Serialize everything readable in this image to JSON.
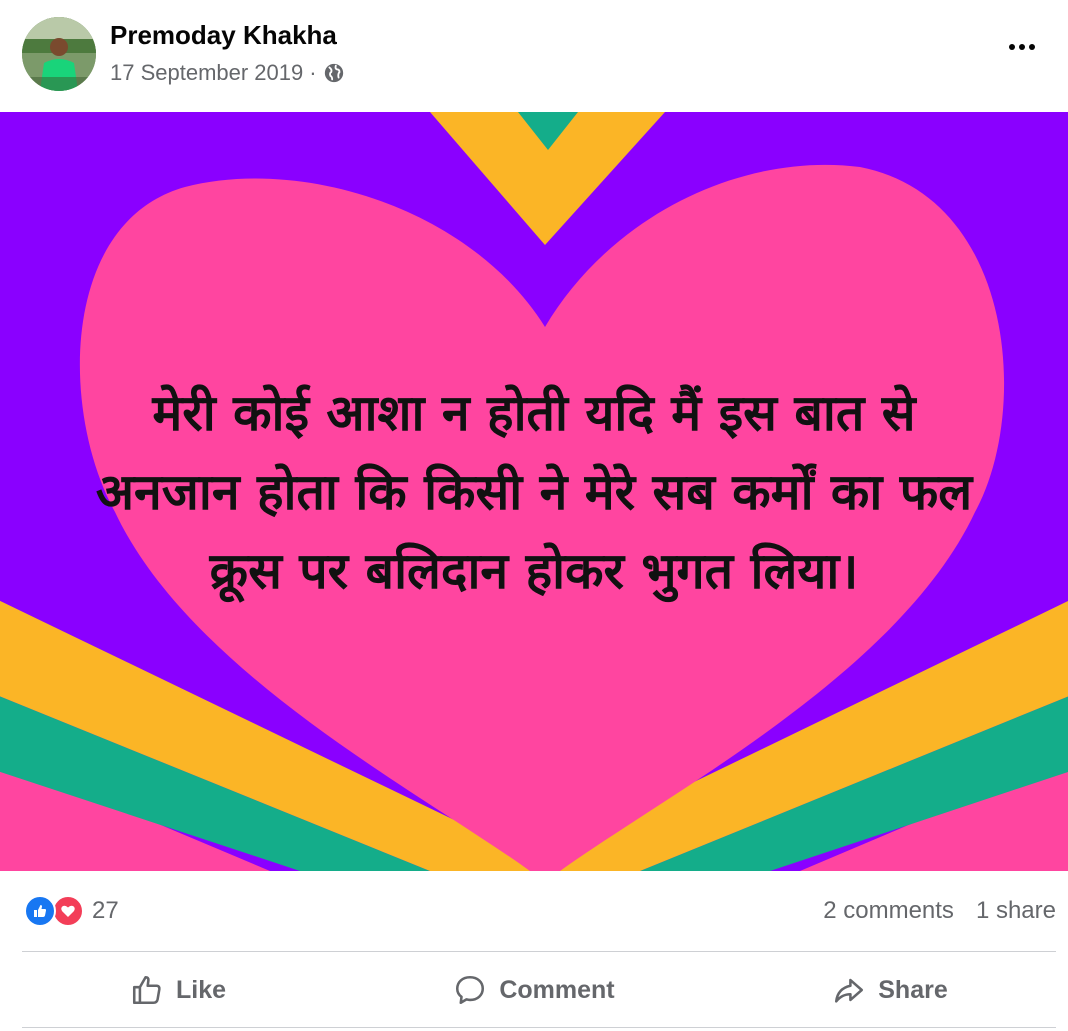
{
  "post": {
    "author_name": "Premoday Khakha",
    "date": "17 September 2019",
    "separator": "·",
    "audience_icon": "globe-icon",
    "menu_icon": "more-options-icon"
  },
  "image": {
    "background_colors": {
      "purple": "#8a00ff",
      "pink": "#ff45a0",
      "yellow": "#fbb526",
      "green": "#14ad8a"
    },
    "text_lines": [
      "मेरी कोई आशा न होती यदि मैं इस बात से",
      "अनजान होता कि किसी ने मेरे सब कर्मों का फल",
      "क्रूस पर बलिदान होकर भुगत लिया।"
    ]
  },
  "reactions": {
    "icons": [
      "like-icon",
      "love-icon"
    ],
    "count": "27",
    "comments": "2 comments",
    "shares": "1 share"
  },
  "actions": {
    "like": "Like",
    "comment": "Comment",
    "share": "Share"
  },
  "colors": {
    "like_blue": "#1877f2",
    "love_red": "#f33e58",
    "secondary_text": "#65676b"
  }
}
